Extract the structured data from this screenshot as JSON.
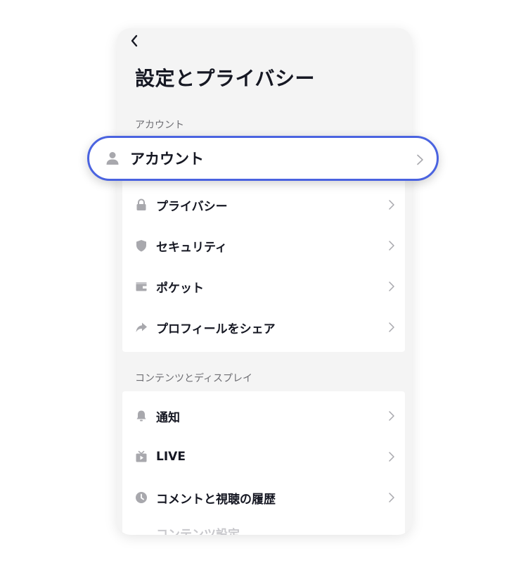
{
  "header": {
    "title": "設定とプライバシー"
  },
  "sections": [
    {
      "label": "アカウント",
      "items": [
        {
          "label": "アカウント",
          "icon": "person-icon"
        },
        {
          "label": "プライバシー",
          "icon": "lock-icon"
        },
        {
          "label": "セキュリティ",
          "icon": "shield-icon"
        },
        {
          "label": "ポケット",
          "icon": "wallet-icon"
        },
        {
          "label": "プロフィールをシェア",
          "icon": "share-arrow-icon"
        }
      ]
    },
    {
      "label": "コンテンツとディスプレイ",
      "items": [
        {
          "label": "通知",
          "icon": "bell-icon"
        },
        {
          "label": "LIVE",
          "icon": "live-tv-icon"
        },
        {
          "label": "コメントと視聴の履歴",
          "icon": "clock-icon"
        },
        {
          "label": "コンテンツ設定",
          "icon": "content-settings-icon"
        }
      ]
    }
  ],
  "colors": {
    "highlight_border": "#4a63e0",
    "icon_gray": "#a8a8ad",
    "text_primary": "#161823",
    "background": "#f4f4f4"
  }
}
